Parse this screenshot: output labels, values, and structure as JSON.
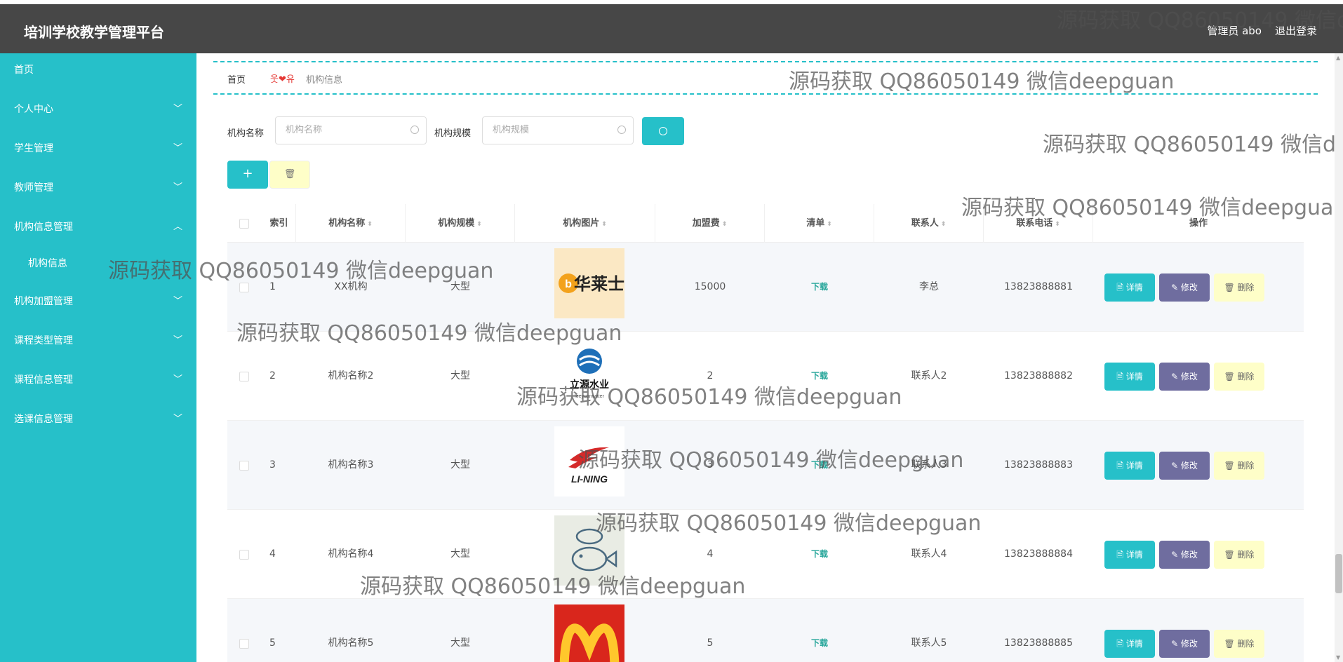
{
  "header": {
    "title": "培训学校教学管理平台",
    "user_label": "管理员 abo",
    "logout_label": "退出登录"
  },
  "sidebar": {
    "items": [
      {
        "label": "首页",
        "expandable": false
      },
      {
        "label": "个人中心",
        "expandable": true,
        "chevron": "﹀"
      },
      {
        "label": "学生管理",
        "expandable": true,
        "chevron": "﹀"
      },
      {
        "label": "教师管理",
        "expandable": true,
        "chevron": "﹀"
      },
      {
        "label": "机构信息管理",
        "expandable": true,
        "chevron": "︿"
      },
      {
        "label": "机构信息",
        "sub": true
      },
      {
        "label": "机构加盟管理",
        "expandable": true,
        "chevron": "﹀"
      },
      {
        "label": "课程类型管理",
        "expandable": true,
        "chevron": "﹀"
      },
      {
        "label": "课程信息管理",
        "expandable": true,
        "chevron": "﹀"
      },
      {
        "label": "选课信息管理",
        "expandable": true,
        "chevron": "﹀"
      }
    ]
  },
  "breadcrumb": {
    "home": "首页",
    "separator": "웃❤유",
    "current": "机构信息"
  },
  "search": {
    "name_label": "机构名称",
    "name_placeholder": "机构名称",
    "scale_label": "机构规模",
    "scale_placeholder": "机构规模"
  },
  "actions": {
    "add_label": "+",
    "batch_delete_label": "🗑"
  },
  "table": {
    "headers": [
      "索引",
      "机构名称",
      "机构规模",
      "机构图片",
      "加盟费",
      "清单",
      "联系人",
      "联系电话",
      "操作"
    ],
    "rows": [
      {
        "index": "1",
        "name": "XX机构",
        "scale": "大型",
        "logo": "hualaishi-logo",
        "fee": "15000",
        "list": "下载",
        "contact": "李总",
        "phone": "13823888881"
      },
      {
        "index": "2",
        "name": "机构名称2",
        "scale": "大型",
        "logo": "liyuan-logo",
        "fee": "2",
        "list": "下载",
        "contact": "联系人2",
        "phone": "13823888882"
      },
      {
        "index": "3",
        "name": "机构名称3",
        "scale": "大型",
        "logo": "lining-logo",
        "fee": "3",
        "list": "下载",
        "contact": "联系人3",
        "phone": "13823888883"
      },
      {
        "index": "4",
        "name": "机构名称4",
        "scale": "大型",
        "logo": "fish-chef-logo",
        "fee": "4",
        "list": "下载",
        "contact": "联系人4",
        "phone": "13823888884"
      },
      {
        "index": "5",
        "name": "机构名称5",
        "scale": "大型",
        "logo": "mcdonalds-logo",
        "fee": "5",
        "list": "下载",
        "contact": "联系人5",
        "phone": "13823888885"
      }
    ],
    "row_actions": {
      "detail": "🗎 详情",
      "edit": "✎ 修改",
      "delete": "🗑 删除"
    }
  },
  "logos": {
    "hualaishi": "华莱士",
    "liyuan": "立源水业",
    "lining": "LI-NING"
  },
  "watermark": "源码获取 QQ86050149 微信deepguan",
  "colors": {
    "accent": "#26c0c9",
    "header": "#474747",
    "edit": "#6f6d9f",
    "delete": "#fefec8"
  }
}
